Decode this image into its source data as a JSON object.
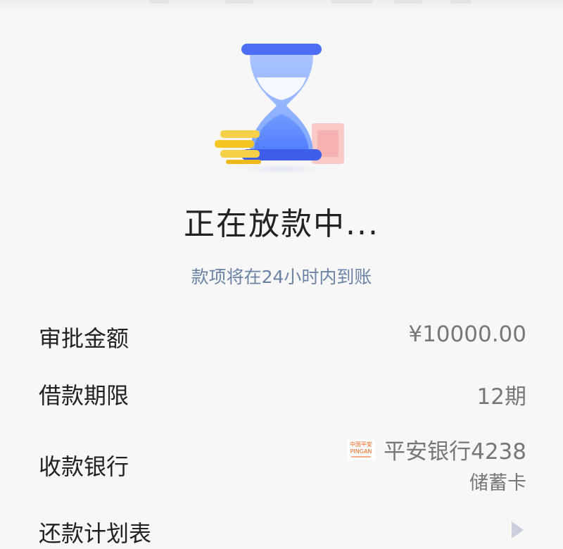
{
  "status": {
    "title": "正在放款中...",
    "subtitle": "款项将在24小时内到账"
  },
  "details": {
    "approved_amount": {
      "label": "审批金额",
      "value": "¥10000.00"
    },
    "loan_term": {
      "label": "借款期限",
      "value": "12期"
    },
    "receiving_bank": {
      "label": "收款银行",
      "bank_name": "平安银行4238",
      "card_type": "储蓄卡",
      "logo_text": "中国平安",
      "logo_subtext": "PINGAN",
      "logo_icon": "ping-an-logo-icon"
    },
    "repayment_schedule": {
      "label": "还款计划表",
      "icon": "chevron-right-icon"
    }
  },
  "colors": {
    "accent_blue": "#4c6ef5",
    "subtitle_blue": "#6b83a6",
    "coin_gold": "#f5c623",
    "logo_orange": "#e8641b"
  }
}
